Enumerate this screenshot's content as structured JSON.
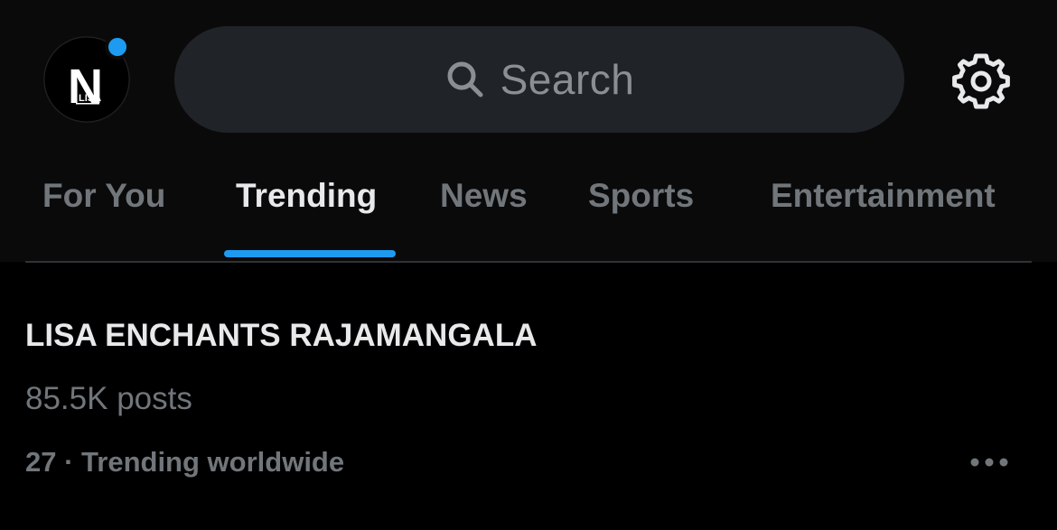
{
  "header": {
    "avatar": {
      "logo_letter": "N",
      "logo_subtext": "LISA",
      "notification_dot_color": "#1d9bf0"
    },
    "search": {
      "placeholder": "Search",
      "icon": "search-icon"
    },
    "settings_icon": "gear-icon"
  },
  "tabs": [
    {
      "label": "For You",
      "active": false
    },
    {
      "label": "Trending",
      "active": true
    },
    {
      "label": "News",
      "active": false
    },
    {
      "label": "Sports",
      "active": false
    },
    {
      "label": "Entertainment",
      "active": false
    }
  ],
  "accent_color": "#1d9bf0",
  "trend": {
    "title": "LISA ENCHANTS RAJAMANGALA",
    "posts": "85.5K posts",
    "rank": "27",
    "separator": " · ",
    "context": "Trending worldwide",
    "more_icon": "more-horizontal-icon"
  }
}
